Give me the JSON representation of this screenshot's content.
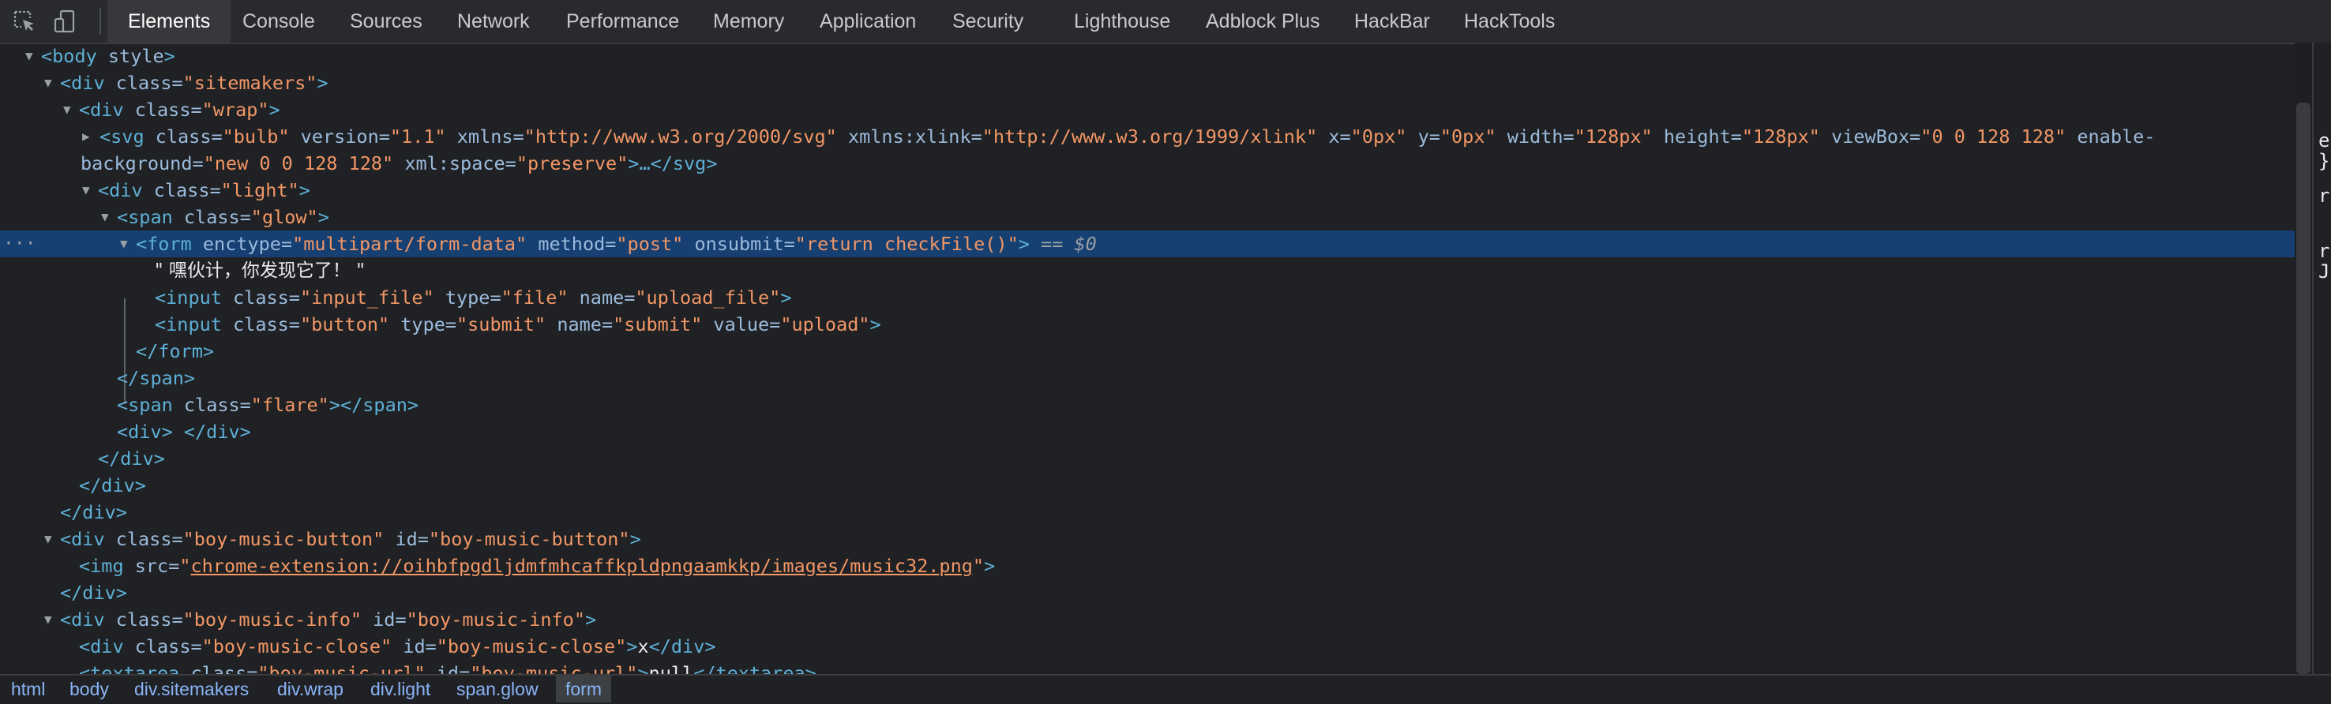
{
  "tabs": [
    "Elements",
    "Console",
    "Sources",
    "Network",
    "Performance",
    "Memory",
    "Application",
    "Security",
    "Lighthouse",
    "Adblock Plus",
    "HackBar",
    "HackTools"
  ],
  "active_tab": "Elements",
  "tree": {
    "body_tag": "<body",
    "body_attr": " style",
    "body_close": ">",
    "sitemakers_open": "<div",
    "sitemakers_cls_name": " class=",
    "sitemakers_cls_val": "\"sitemakers\"",
    "sitemakers_end": ">",
    "wrap_open": "<div",
    "wrap_cls_name": " class=",
    "wrap_cls_val": "\"wrap\"",
    "wrap_end": ">",
    "svg_open": "<svg",
    "svg_a1": " class=",
    "svg_v1": "\"bulb\"",
    "svg_a2": " version=",
    "svg_v2": "\"1.1\"",
    "svg_a3": " xmlns=",
    "svg_v3": "\"http://www.w3.org/2000/svg\"",
    "svg_a4": " xmlns:xlink=",
    "svg_v4": "\"http://www.w3.org/1999/xlink\"",
    "svg_a5": " x=",
    "svg_v5": "\"0px\"",
    "svg_a6": " y=",
    "svg_v6": "\"0px\"",
    "svg_a7": " width=",
    "svg_v7": "\"128px\"",
    "svg_a8": " height=",
    "svg_v8": "\"128px\"",
    "svg_a9": " viewBox=",
    "svg_v9": "\"0 0 128 128\"",
    "svg_a10": " enable-",
    "svg_a10b": "background=",
    "svg_v10": "\"new 0 0 128 128\"",
    "svg_a11": " xml:space=",
    "svg_v11": "\"preserve\"",
    "svg_end": ">…</svg>",
    "light_open": "<div",
    "light_cls_name": " class=",
    "light_cls_val": "\"light\"",
    "light_end": ">",
    "glow_open": "<span",
    "glow_cls_name": " class=",
    "glow_cls_val": "\"glow\"",
    "glow_end": ">",
    "form_open": "<form",
    "form_a1": " enctype=",
    "form_v1": "\"multipart/form-data\"",
    "form_a2": " method=",
    "form_v2": "\"post\"",
    "form_a3": " onsubmit=",
    "form_v3": "\"return checkFile()\"",
    "form_end": ">",
    "form_eq": " == ",
    "form_dollar": "$0",
    "text_node": "\" 嘿伙计，你发现它了！ \"",
    "in1_open": "<input",
    "in1_a1": " class=",
    "in1_v1": "\"input_file\"",
    "in1_a2": " type=",
    "in1_v2": "\"file\"",
    "in1_a3": " name=",
    "in1_v3": "\"upload_file\"",
    "in1_end": ">",
    "in2_open": "<input",
    "in2_a1": " class=",
    "in2_v1": "\"button\"",
    "in2_a2": " type=",
    "in2_v2": "\"submit\"",
    "in2_a3": " name=",
    "in2_v3": "\"submit\"",
    "in2_a4": " value=",
    "in2_v4": "\"upload\"",
    "in2_end": ">",
    "form_close": "</form>",
    "span_close": "</span>",
    "flare_open": "<span",
    "flare_cls_name": " class=",
    "flare_cls_val": "\"flare\"",
    "flare_end": "></span>",
    "emptydiv": "<div> </div>",
    "div_close": "</div>",
    "bmb_open": "<div",
    "bmb_a1": " class=",
    "bmb_v1": "\"boy-music-button\"",
    "bmb_a2": " id=",
    "bmb_v2": "\"boy-music-button\"",
    "bmb_end": ">",
    "img_open": "<img",
    "img_a1": " src=",
    "img_q": "\"",
    "img_link": "chrome-extension://oihbfpgdljdmfmhcaffkpldpngaamkkp/images/music32.png",
    "img_end": ">",
    "bmi_open": "<div",
    "bmi_a1": " class=",
    "bmi_v1": "\"boy-music-info\"",
    "bmi_a2": " id=",
    "bmi_v2": "\"boy-music-info\"",
    "bmi_end": ">",
    "bmc_open": "<div",
    "bmc_a1": " class=",
    "bmc_v1": "\"boy-music-close\"",
    "bmc_a2": " id=",
    "bmc_v2": "\"boy-music-close\"",
    "bmc_end": ">",
    "bmc_text": "x",
    "bmc_close": "</div>",
    "ta_open": "<textarea",
    "ta_a1": " class=",
    "ta_v1": "\"boy-music-url\"",
    "ta_a2": " id=",
    "ta_v2": "\"boy-music-url\"",
    "ta_end": ">",
    "ta_text": "null",
    "ta_close": "</textarea>"
  },
  "breadcrumbs": [
    "html",
    "body",
    "div.sitemakers",
    "div.wrap",
    "div.light",
    "span.glow",
    "form"
  ],
  "side_glyphs": [
    "e",
    "}",
    "r",
    "r",
    "J"
  ]
}
